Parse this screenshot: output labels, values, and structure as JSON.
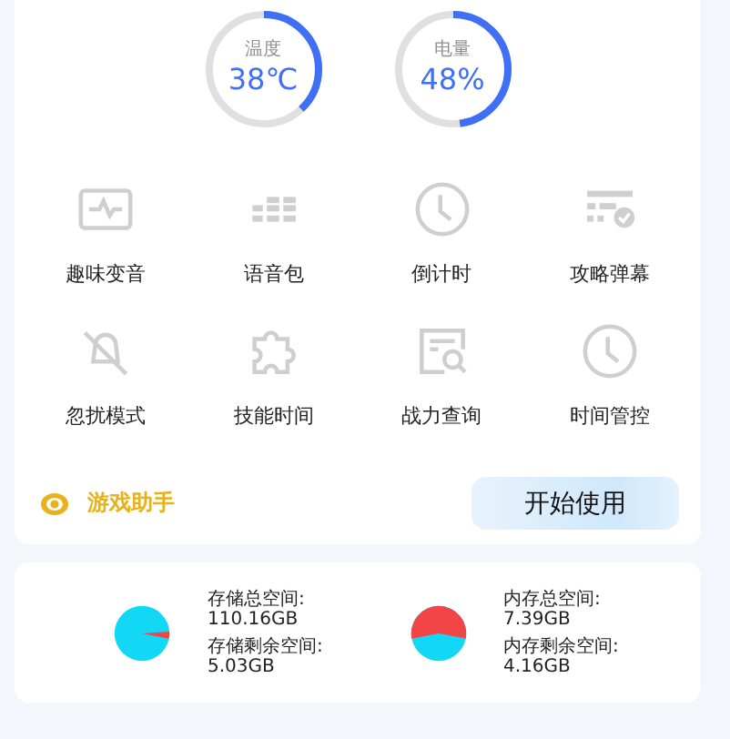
{
  "gauges": [
    {
      "label": "温度",
      "value": "38℃"
    },
    {
      "label": "电量",
      "value": "48%"
    }
  ],
  "tools": [
    {
      "label": "趣味变音",
      "kind": "wave"
    },
    {
      "label": "语音包",
      "kind": "grid"
    },
    {
      "label": "倒计时",
      "kind": "clock"
    },
    {
      "label": "攻略弹幕",
      "kind": "list"
    },
    {
      "label": "忽扰模式",
      "kind": "bell"
    },
    {
      "label": "技能时间",
      "kind": "puzzle"
    },
    {
      "label": "战力查询",
      "kind": "search"
    },
    {
      "label": "时间管控",
      "kind": "clock"
    }
  ],
  "assistant": {
    "label": "游戏助手",
    "button": "开始使用"
  },
  "storage": [
    {
      "kind": "disk",
      "total_label": "存储总空间:",
      "total": "110.16GB",
      "free_label": "存储剩余空间:",
      "free": "5.03GB"
    },
    {
      "kind": "memory",
      "total_label": "内存总空间:",
      "total": "7.39GB",
      "free_label": "内存剩余空间:",
      "free": "4.16GB"
    }
  ]
}
